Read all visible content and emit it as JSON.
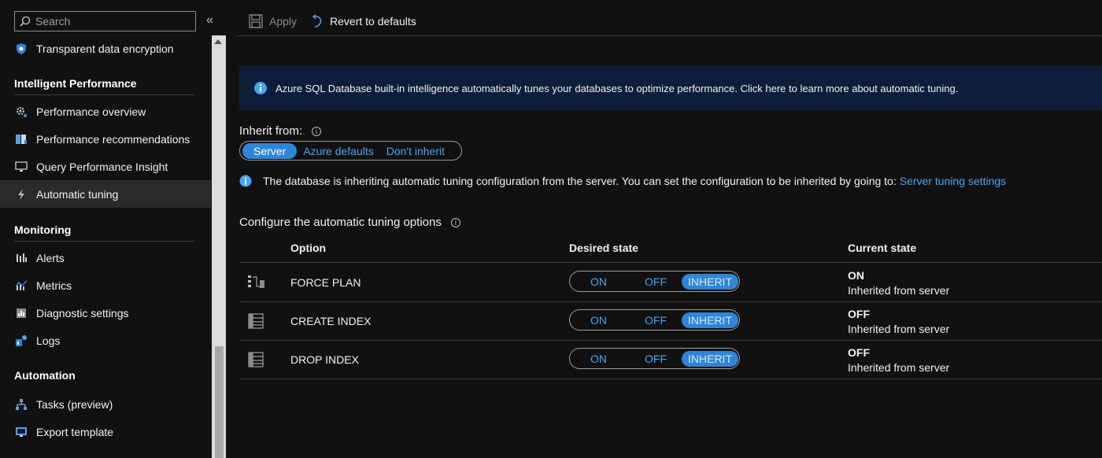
{
  "sidebar": {
    "search_placeholder": "Search",
    "collapse_glyph": "«",
    "items_top": [
      {
        "label": "Transparent data encryption",
        "icon": "shield-icon"
      }
    ],
    "sections": [
      {
        "title": "Intelligent Performance",
        "items": [
          {
            "label": "Performance overview",
            "icon": "gear-chart-icon"
          },
          {
            "label": "Performance recommendations",
            "icon": "book-icon"
          },
          {
            "label": "Query Performance Insight",
            "icon": "monitor-icon"
          },
          {
            "label": "Automatic tuning",
            "icon": "lightning-icon",
            "selected": true
          }
        ]
      },
      {
        "title": "Monitoring",
        "items": [
          {
            "label": "Alerts",
            "icon": "alerts-icon"
          },
          {
            "label": "Metrics",
            "icon": "metrics-icon"
          },
          {
            "label": "Diagnostic settings",
            "icon": "diagnostic-icon"
          },
          {
            "label": "Logs",
            "icon": "logs-icon"
          }
        ]
      },
      {
        "title": "Automation",
        "items": [
          {
            "label": "Tasks (preview)",
            "icon": "tasks-icon"
          },
          {
            "label": "Export template",
            "icon": "export-icon"
          }
        ]
      }
    ]
  },
  "toolbar": {
    "apply_label": "Apply",
    "revert_label": "Revert to defaults"
  },
  "banner": {
    "text": "Azure SQL Database built-in intelligence automatically tunes your databases to optimize performance. Click here to learn more about automatic tuning."
  },
  "inherit": {
    "label": "Inherit from:",
    "options": [
      "Server",
      "Azure defaults",
      "Don't inherit"
    ],
    "selected": "Server",
    "message": "The database is inheriting automatic tuning configuration from the server. You can set the configuration to be inherited by going to:",
    "link": "Server tuning settings"
  },
  "configure": {
    "title": "Configure the automatic tuning options",
    "headers": {
      "option": "Option",
      "desired": "Desired state",
      "current": "Current state"
    },
    "rows": [
      {
        "name": "FORCE PLAN",
        "icon": "force-plan-icon",
        "desired": "INHERIT",
        "current": "ON",
        "current_note": "Inherited from server"
      },
      {
        "name": "CREATE INDEX",
        "icon": "create-index-icon",
        "desired": "INHERIT",
        "current": "OFF",
        "current_note": "Inherited from server"
      },
      {
        "name": "DROP INDEX",
        "icon": "drop-index-icon",
        "desired": "INHERIT",
        "current": "OFF",
        "current_note": "Inherited from server"
      }
    ],
    "toggle_labels": {
      "on": "ON",
      "off": "OFF",
      "inherit": "INHERIT"
    }
  },
  "colors": {
    "accent": "#2f85d8",
    "link": "#4aa3f0",
    "banner": "#0c1e3a"
  }
}
